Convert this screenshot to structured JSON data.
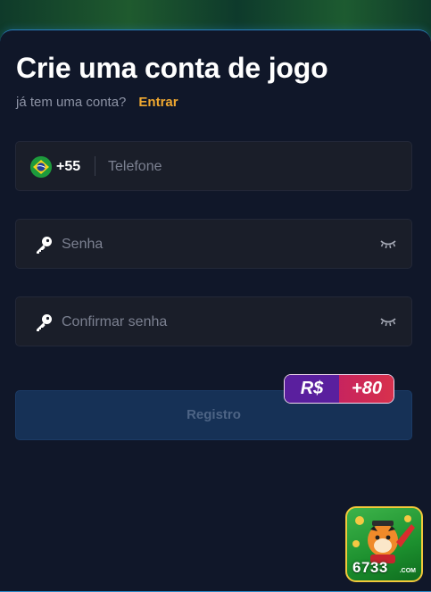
{
  "header": {
    "title": "Crie uma conta de jogo",
    "login_prompt": "já tem uma conta?",
    "login_link": "Entrar"
  },
  "form": {
    "phone": {
      "country_code": "+55",
      "placeholder": "Telefone",
      "value": "",
      "flag_icon": "brazil-flag-icon"
    },
    "password": {
      "placeholder": "Senha",
      "value": "",
      "icon": "key-icon",
      "toggle_icon": "eye-closed-icon"
    },
    "confirm_password": {
      "placeholder": "Confirmar senha",
      "value": "",
      "icon": "key-icon",
      "toggle_icon": "eye-closed-icon"
    },
    "submit_label": "Registro"
  },
  "bonus": {
    "currency": "R$",
    "amount": "+80"
  },
  "app_badge": {
    "label": "6733",
    "suffix": ".COM"
  },
  "colors": {
    "background": "#101729",
    "accent_link": "#f0a830",
    "button": "#163156",
    "bonus_left": "#5a1f9e",
    "bonus_right": "#d8314c"
  }
}
